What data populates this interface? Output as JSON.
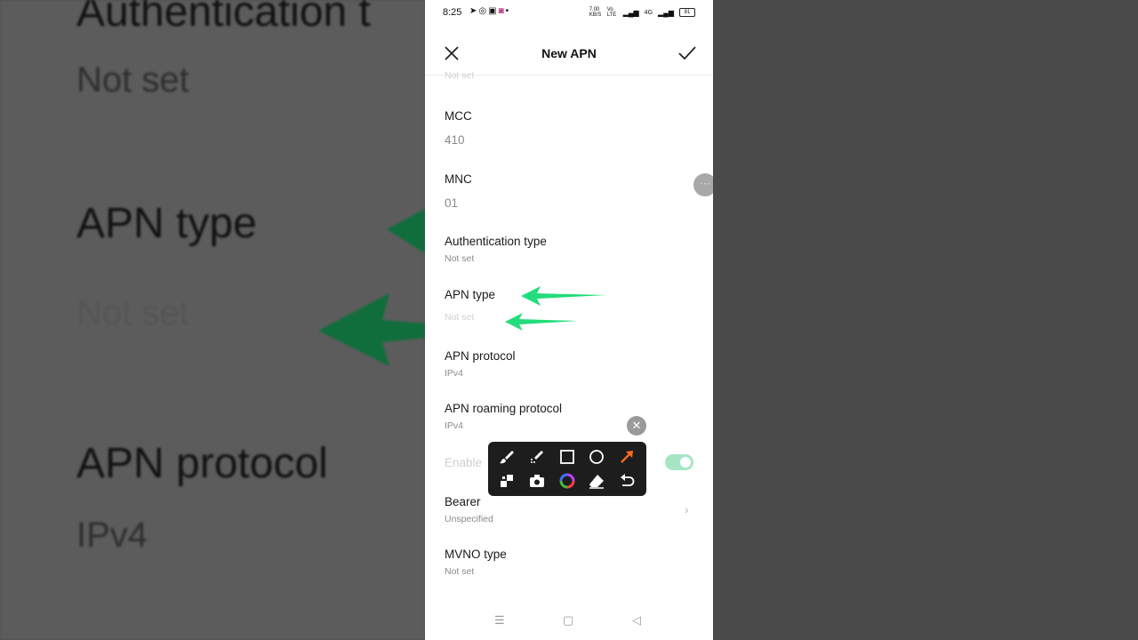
{
  "status_bar": {
    "time": "8:25",
    "left_icons": [
      "telegram-icon",
      "whatsapp-icon",
      "facebook-icon",
      "instagram-icon",
      "dot"
    ],
    "speed": "7.00 KB/S",
    "net1": "Vo LTE",
    "net2": "4G",
    "battery": "81"
  },
  "appbar": {
    "title": "New APN"
  },
  "fields": {
    "top_partial_value": "Not set",
    "mcc": {
      "label": "MCC",
      "value": "410"
    },
    "mnc": {
      "label": "MNC",
      "value": "01"
    },
    "auth": {
      "label": "Authentication type",
      "value": "Not set"
    },
    "apn_type": {
      "label": "APN type",
      "value": "Not set"
    },
    "apn_protocol": {
      "label": "APN protocol",
      "value": "IPv4"
    },
    "apn_roaming": {
      "label": "APN roaming protocol",
      "value": "IPv4"
    },
    "enable": {
      "label": "Enable"
    },
    "bearer": {
      "label": "Bearer",
      "value": "Unspecified"
    },
    "mvno": {
      "label": "MVNO type",
      "value": "Not set"
    }
  },
  "background": {
    "line1": "Authentication t",
    "line2": "Not set",
    "line3": "APN type",
    "line4": "Not set",
    "line5": "APN protocol",
    "line6": "IPv4"
  },
  "colors": {
    "arrow_green": "#22dd7a",
    "toggle_on": "#a7e6c5",
    "toolbar_bg": "#1d1d1d",
    "accent_orange": "#ff6a1a"
  }
}
